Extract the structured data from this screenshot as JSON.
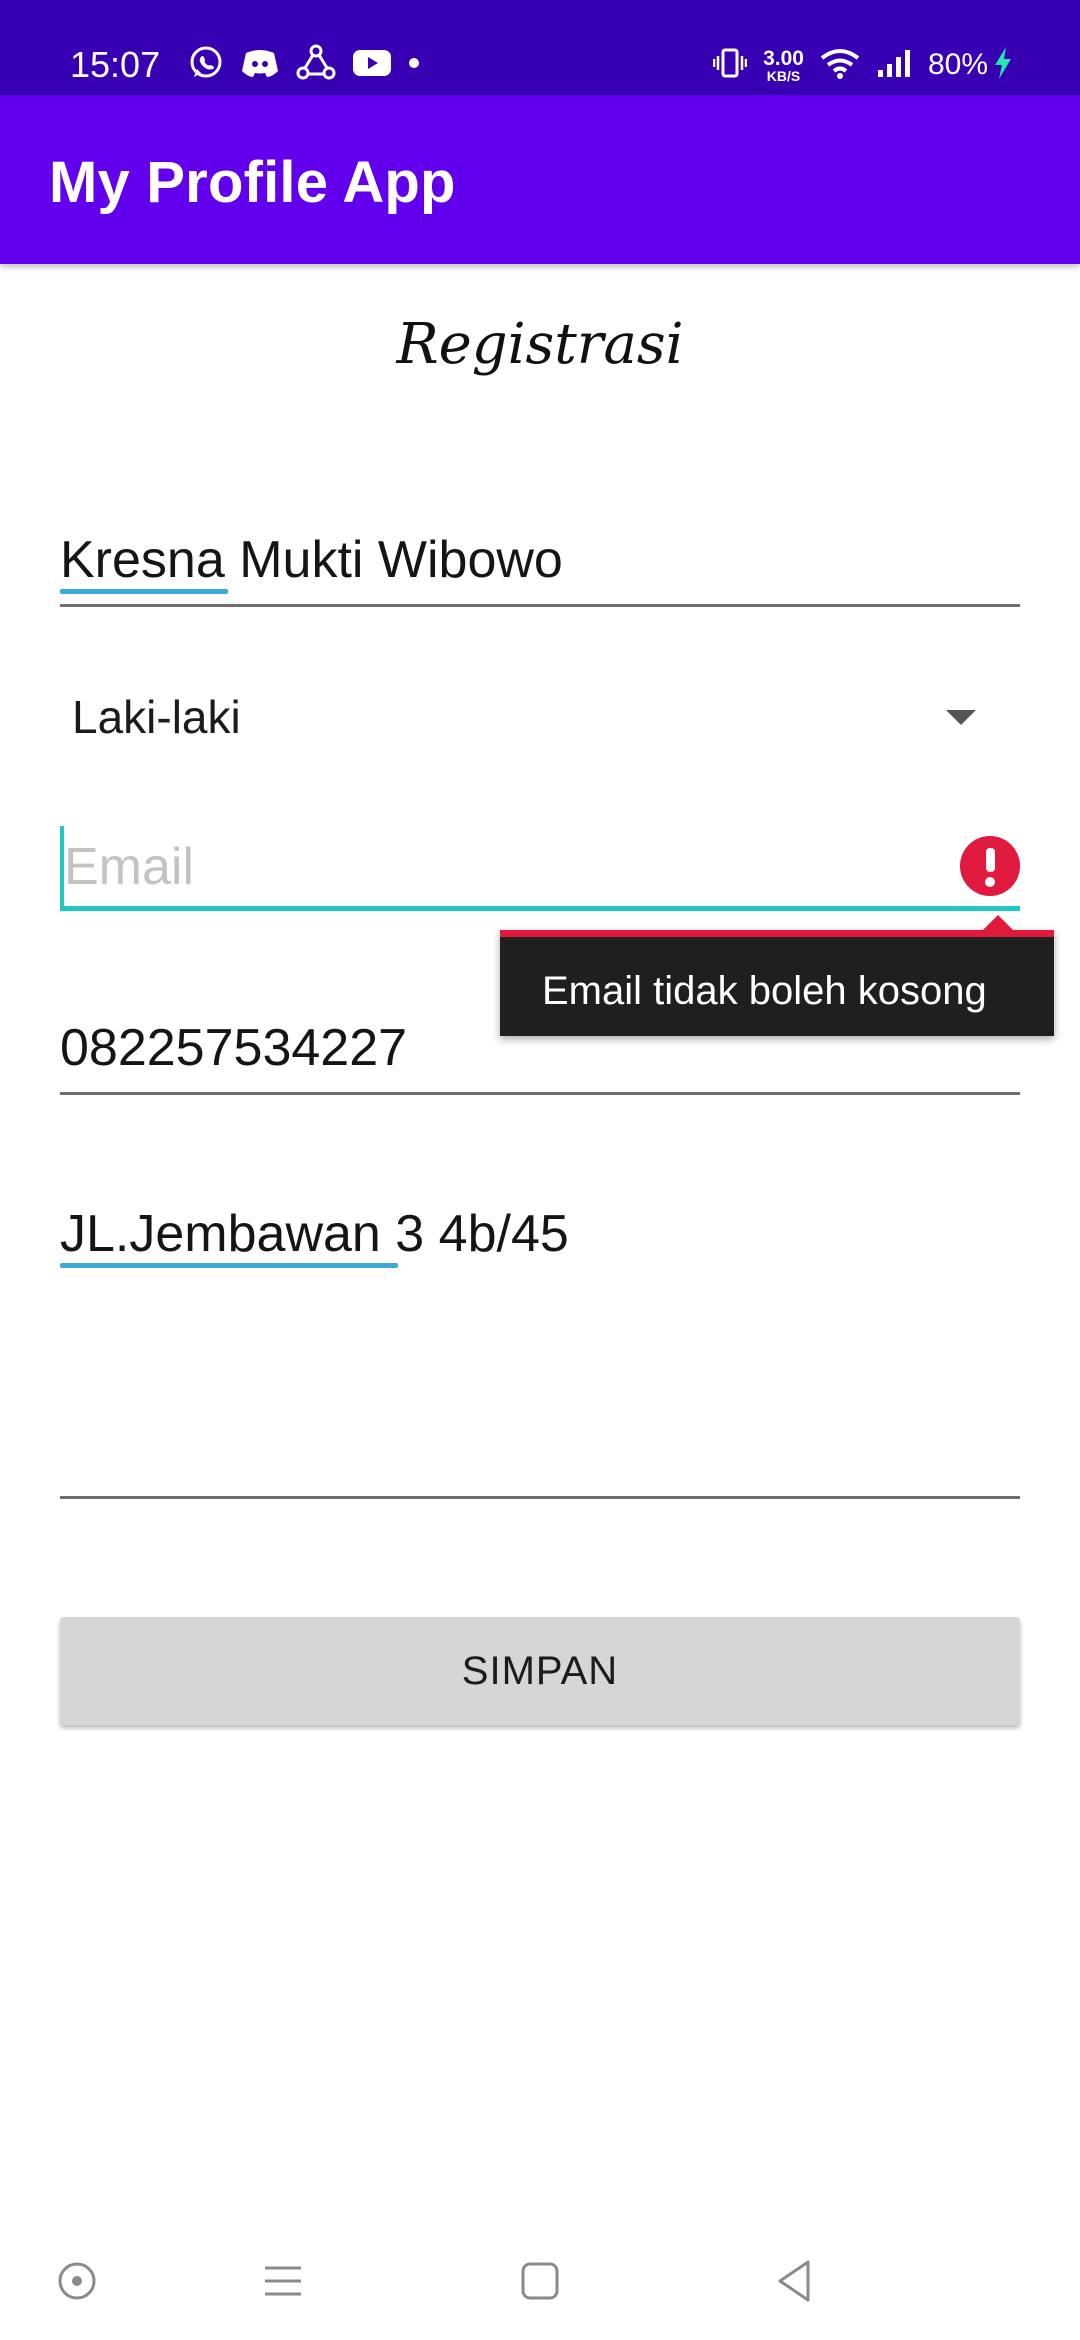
{
  "status_bar": {
    "time": "15:07",
    "net_speed_value": "3.00",
    "net_speed_unit": "KB/S",
    "battery": "80%",
    "background_color": "#3700b3",
    "left_icons": [
      "whatsapp-icon",
      "discord-icon",
      "share-icon",
      "youtube-icon",
      "dot-icon"
    ],
    "right_icons": [
      "vibrate-icon",
      "wifi-icon",
      "signal-icon",
      "charging-icon"
    ]
  },
  "app_bar": {
    "title": "My Profile App",
    "background_color": "#6200ee"
  },
  "form": {
    "heading": "Registrasi",
    "name_value": "Kresna Mukti Wibowo",
    "gender_value": "Laki-laki",
    "email_placeholder": "Email",
    "email_value": "",
    "email_error": "Email tidak boleh kosong",
    "phone_value": "082257534227",
    "address_value": "JL.Jembawan 3 4b/45",
    "submit_label": "SIMPAN",
    "accent_color": "#1fc8c0",
    "error_color": "#e0193f"
  },
  "nav_bar": {
    "icons": [
      "assistant-icon",
      "recents-icon",
      "home-icon",
      "back-icon"
    ]
  }
}
